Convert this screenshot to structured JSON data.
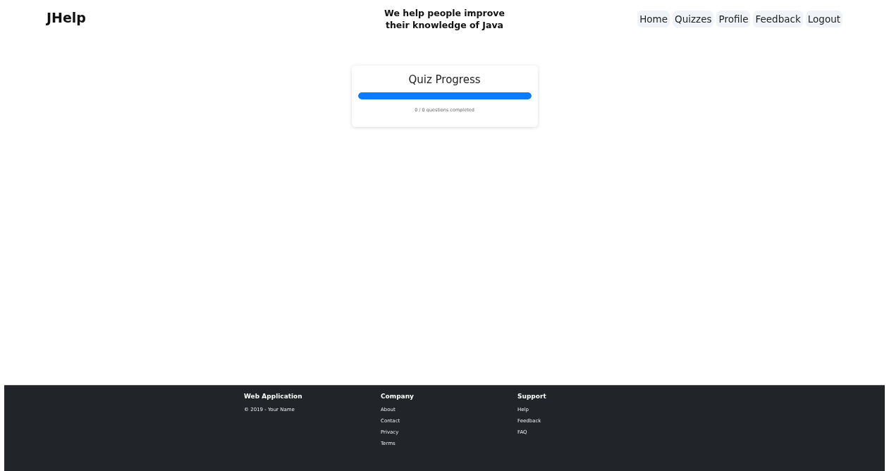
{
  "header": {
    "brand": "JHelp",
    "tagline": "We help people improve their knowledge of Java",
    "nav": [
      {
        "label": "Home"
      },
      {
        "label": "Quizzes"
      },
      {
        "label": "Profile"
      },
      {
        "label": "Feedback"
      },
      {
        "label": "Logout"
      }
    ]
  },
  "progress_card": {
    "title": "Quiz Progress",
    "level": 1,
    "caption": "0 / 0 questions completed"
  },
  "footer": {
    "columns": [
      {
        "heading": "Web Application",
        "texts": [
          "© 2019 - Your Name"
        ]
      },
      {
        "heading": "Company",
        "links": [
          "About",
          "Contact",
          "Privacy",
          "Terms"
        ]
      },
      {
        "heading": "Support",
        "links": [
          "Help",
          "Feedback",
          "FAQ"
        ]
      }
    ]
  }
}
